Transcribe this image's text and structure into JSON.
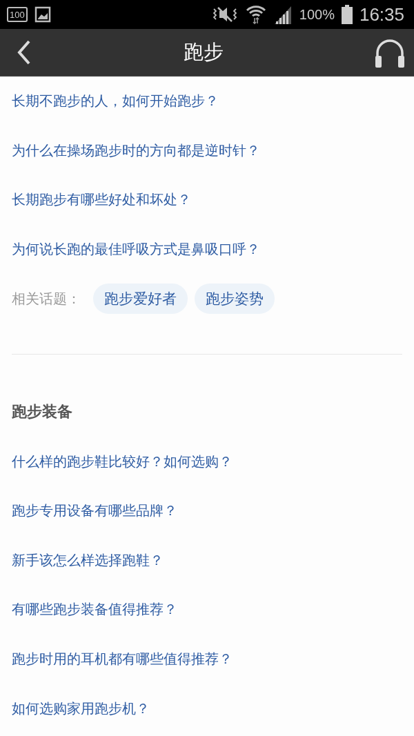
{
  "status_bar": {
    "badge": "100",
    "battery_percent": "100%",
    "time": "16:35"
  },
  "header": {
    "title": "跑步"
  },
  "questions": [
    "长期不跑步的人，如何开始跑步？",
    "为什么在操场跑步时的方向都是逆时针？",
    "长期跑步有哪些好处和坏处？",
    "为何说长跑的最佳呼吸方式是鼻吸口呼？"
  ],
  "related_topics": {
    "label": "相关话题：",
    "tags": [
      "跑步爱好者",
      "跑步姿势"
    ]
  },
  "sections": [
    {
      "title": "跑步装备",
      "questions": [
        "什么样的跑步鞋比较好？如何选购？",
        "跑步专用设备有哪些品牌？",
        "新手该怎么样选择跑鞋？",
        "有哪些跑步装备值得推荐？",
        "跑步时用的耳机都有哪些值得推荐？",
        "如何选购家用跑步机？"
      ]
    }
  ]
}
